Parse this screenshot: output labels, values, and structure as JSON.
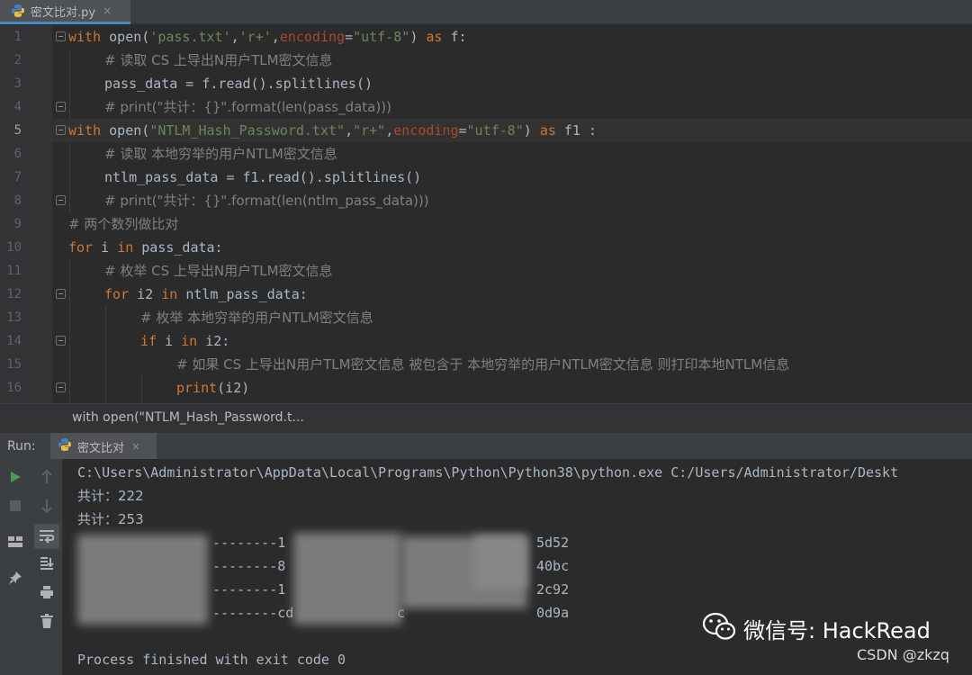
{
  "tab": {
    "label": "密文比对.py",
    "close": "×"
  },
  "editor": {
    "line_numbers": [
      "1",
      "2",
      "3",
      "4",
      "5",
      "6",
      "7",
      "8",
      "9",
      "10",
      "11",
      "12",
      "13",
      "14",
      "15",
      "16"
    ],
    "lines": [
      {
        "parts": [
          [
            "kw",
            "with "
          ],
          [
            "fn",
            "open("
          ],
          [
            "str",
            "'pass.txt'"
          ],
          [
            "fn",
            ","
          ],
          [
            "str",
            "'r+'"
          ],
          [
            "fn",
            ","
          ],
          [
            "kwarg",
            "encoding"
          ],
          [
            "fn",
            "="
          ],
          [
            "str",
            "\"utf-8\""
          ],
          [
            "fn",
            ") "
          ],
          [
            "kw",
            "as"
          ],
          [
            "fn",
            " f:"
          ]
        ]
      },
      {
        "indent": 1,
        "parts": [
          [
            "cm",
            "# 读取 CS 上导出N用户TLM密文信息"
          ]
        ]
      },
      {
        "indent": 1,
        "parts": [
          [
            "fn",
            "pass_data = f.read().splitlines()"
          ]
        ]
      },
      {
        "indent": 1,
        "parts": [
          [
            "cm",
            "# print(\"共计：{}\".format(len(pass_data)))"
          ]
        ]
      },
      {
        "parts": [
          [
            "kw",
            "with "
          ],
          [
            "fn",
            "open("
          ],
          [
            "str",
            "\"NTLM_Hash_Password.txt\""
          ],
          [
            "fn",
            ","
          ],
          [
            "str",
            "\"r+\""
          ],
          [
            "fn",
            ","
          ],
          [
            "kwarg",
            "encoding"
          ],
          [
            "fn",
            "="
          ],
          [
            "str",
            "\"utf-8\""
          ],
          [
            "fn",
            ") "
          ],
          [
            "kw",
            "as"
          ],
          [
            "fn",
            " f1 :"
          ]
        ]
      },
      {
        "indent": 1,
        "parts": [
          [
            "cm",
            "# 读取 本地穷举的用户NTLM密文信息"
          ]
        ]
      },
      {
        "indent": 1,
        "parts": [
          [
            "fn",
            "ntlm_pass_data = f1.read().splitlines()"
          ]
        ]
      },
      {
        "indent": 1,
        "parts": [
          [
            "cm",
            "# print(\"共计：{}\".format(len(ntlm_pass_data)))"
          ]
        ]
      },
      {
        "parts": [
          [
            "cm",
            "# 两个数列做比对"
          ]
        ]
      },
      {
        "parts": [
          [
            "kw",
            "for "
          ],
          [
            "fn",
            "i "
          ],
          [
            "kw",
            "in "
          ],
          [
            "fn",
            "pass_data:"
          ]
        ]
      },
      {
        "indent": 1,
        "parts": [
          [
            "cm",
            "# 枚举 CS 上导出N用户TLM密文信息"
          ]
        ]
      },
      {
        "indent": 1,
        "parts": [
          [
            "kw",
            "for "
          ],
          [
            "fn",
            "i2 "
          ],
          [
            "kw",
            "in "
          ],
          [
            "fn",
            "ntlm_pass_data:"
          ]
        ]
      },
      {
        "indent": 2,
        "parts": [
          [
            "cm",
            "# 枚举 本地穷举的用户NTLM密文信息"
          ]
        ]
      },
      {
        "indent": 2,
        "parts": [
          [
            "kw",
            "if "
          ],
          [
            "fn",
            "i "
          ],
          [
            "kw",
            "in "
          ],
          [
            "fn",
            "i2:"
          ]
        ]
      },
      {
        "indent": 3,
        "parts": [
          [
            "cm",
            "# 如果 CS 上导出N用户TLM密文信息 被包含于 本地穷举的用户NTLM密文信息 则打印本地NTLM信息"
          ]
        ]
      },
      {
        "indent": 3,
        "parts": [
          [
            "kw",
            "print"
          ],
          [
            "fn",
            "(i2)"
          ]
        ]
      }
    ]
  },
  "breadcrumb": {
    "text": "with open(\"NTLM_Hash_Password.t..."
  },
  "run": {
    "label": "Run:",
    "tab_label": "密文比对",
    "tab_close": "×",
    "console": {
      "command": "C:\\Users\\Administrator\\AppData\\Local\\Programs\\Python\\Python38\\python.exe C:/Users/Administrator/Deskt",
      "count1": "共计：222",
      "count2": "共计：253",
      "redacted": [
        {
          "frag1": "--------1",
          "frag2": "5d52"
        },
        {
          "frag1": "--------8",
          "frag2": "40bc"
        },
        {
          "frag1": "--------1",
          "frag2": "2c92"
        },
        {
          "frag1": "--------cd",
          "frag2": "c",
          "frag3": "0d9a"
        }
      ],
      "exit_line": "Process finished with exit code 0"
    }
  },
  "watermark": {
    "wechat": "微信号: HackRead",
    "csdn": "CSDN @zkzq"
  }
}
